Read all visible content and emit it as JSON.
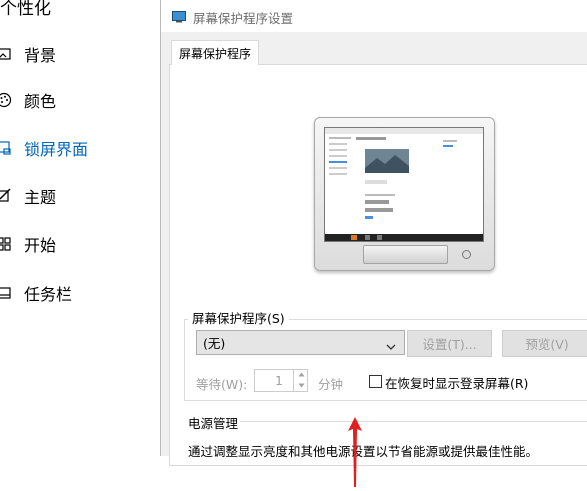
{
  "settings": {
    "title": "个性化",
    "nav": [
      {
        "label": "背景",
        "icon": "image-icon"
      },
      {
        "label": "颜色",
        "icon": "palette-icon"
      },
      {
        "label": "锁屏界面",
        "icon": "lock-screen-icon",
        "active": true
      },
      {
        "label": "主题",
        "icon": "brush-icon"
      },
      {
        "label": "开始",
        "icon": "start-grid-icon"
      },
      {
        "label": "任务栏",
        "icon": "taskbar-icon"
      }
    ]
  },
  "dialog": {
    "title": "屏幕保护程序设置",
    "tab": "屏幕保护程序",
    "screensaver_group_label": "屏幕保护程序(S)",
    "screensaver_select_value": "(无)",
    "settings_button": "设置(T)...",
    "preview_button": "预览(V)",
    "wait_label": "等待(W):",
    "wait_value": "1",
    "minutes_label": "分钟",
    "resume_checkbox_label": "在恢复时显示登录屏幕(R)",
    "resume_checked": false,
    "power_title": "电源管理",
    "power_description": "通过调整显示亮度和其他电源设置以节省能源或提供最佳性能。"
  },
  "colors": {
    "accent": "#0067b8",
    "annotation_arrow": "#e02020"
  }
}
